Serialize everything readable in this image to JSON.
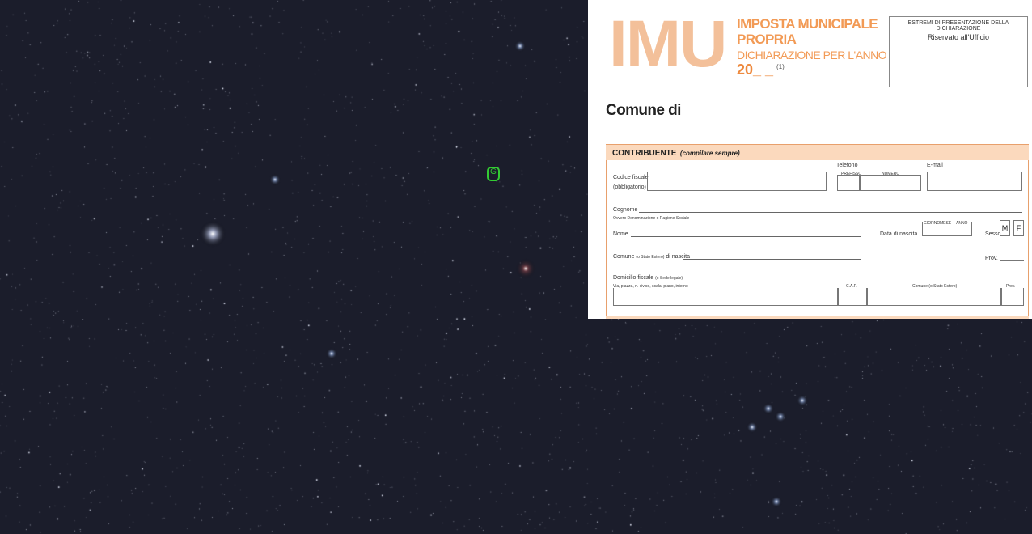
{
  "form": {
    "logo": "IMU",
    "title": "IMPOSTA MUNICIPALE PROPRIA",
    "subtitle": "DICHIARAZIONE PER L'ANNO",
    "year": "20_ _",
    "footnote_ref": "(1)",
    "reserved_title": "ESTREMI DI PRESENTAZIONE DELLA DICHIARAZIONE",
    "reserved_label": "Riservato all'Ufficio",
    "comune_label": "Comune di",
    "section_title": "CONTRIBUENTE",
    "section_note": "(compilare sempre)",
    "fields": {
      "codice_fiscale": "Codice fiscale",
      "codice_fiscale_note": "(obbligatorio)",
      "telefono": "Telefono",
      "prefisso": "PREFISSO",
      "numero": "NUMERO",
      "email": "E-mail",
      "cognome": "Cognome",
      "cognome_note": "Ovvero Denominazione o Ragione Sociale",
      "nome": "Nome",
      "data_nascita": "Data di nascita",
      "giorno": "GIORNO",
      "mese": "MESE",
      "anno": "ANNO",
      "sesso": "Sesso",
      "m": "M",
      "f": "F",
      "comune_nascita": "Comune",
      "comune_nascita_note": "(o Stato Estero)",
      "comune_nascita_suffix": "di nascita",
      "prov": "Prov.",
      "domicilio": "Domicilio fiscale",
      "domicilio_note": "(o Sede legale)",
      "indirizzo_note": "Via, piazza, n. civico, scala, piano, interno",
      "cap": "C.A.P.",
      "comune_estero": "Comune (o Stato Estero)",
      "prov2": "Prov."
    }
  },
  "sky_label": "G",
  "colors": {
    "sky": "#1b1d2b",
    "form_accent": "#f29a55",
    "form_bar": "#fbd9bd"
  }
}
